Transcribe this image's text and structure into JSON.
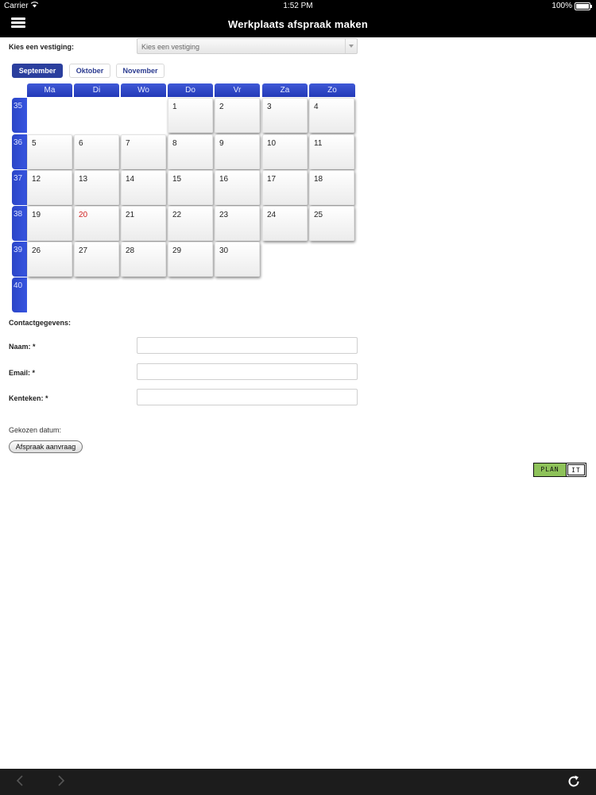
{
  "status_bar": {
    "carrier": "Carrier",
    "time": "1:52 PM",
    "battery": "100%"
  },
  "header": {
    "title": "Werkplaats afspraak maken"
  },
  "vestiging": {
    "label": "Kies een vestiging:",
    "value": "Kies een vestiging"
  },
  "months": [
    {
      "label": "September",
      "active": true
    },
    {
      "label": "Oktober",
      "active": false
    },
    {
      "label": "November",
      "active": false
    }
  ],
  "calendar": {
    "day_names": [
      "Ma",
      "Di",
      "Wo",
      "Do",
      "Vr",
      "Za",
      "Zo"
    ],
    "weeks": [
      {
        "num": "35",
        "days": [
          "",
          "",
          "",
          "1",
          "2",
          "3",
          "4"
        ]
      },
      {
        "num": "36",
        "days": [
          "5",
          "6",
          "7",
          "8",
          "9",
          "10",
          "11"
        ]
      },
      {
        "num": "37",
        "days": [
          "12",
          "13",
          "14",
          "15",
          "16",
          "17",
          "18"
        ]
      },
      {
        "num": "38",
        "days": [
          "19",
          "20",
          "21",
          "22",
          "23",
          "24",
          "25"
        ]
      },
      {
        "num": "39",
        "days": [
          "26",
          "27",
          "28",
          "29",
          "30",
          "",
          ""
        ]
      },
      {
        "num": "40",
        "days": [
          "",
          "",
          "",
          "",
          "",
          "",
          ""
        ]
      }
    ],
    "today": "20",
    "today_color": "#d01f1f"
  },
  "contact": {
    "heading": "Contactgegevens:",
    "fields": [
      {
        "label": "Naam: *",
        "value": ""
      },
      {
        "label": "Email: *",
        "value": ""
      },
      {
        "label": "Kenteken: *",
        "value": ""
      }
    ]
  },
  "chosen_date_label": "Gekozen datum:",
  "submit_label": "Afspraak aanvraag",
  "logo": {
    "left": "PLAN",
    "right": "IT"
  },
  "colors": {
    "accent": "#2b3f9e",
    "calendar_blue": "#3150d4",
    "logo_green": "#8ec25a"
  }
}
